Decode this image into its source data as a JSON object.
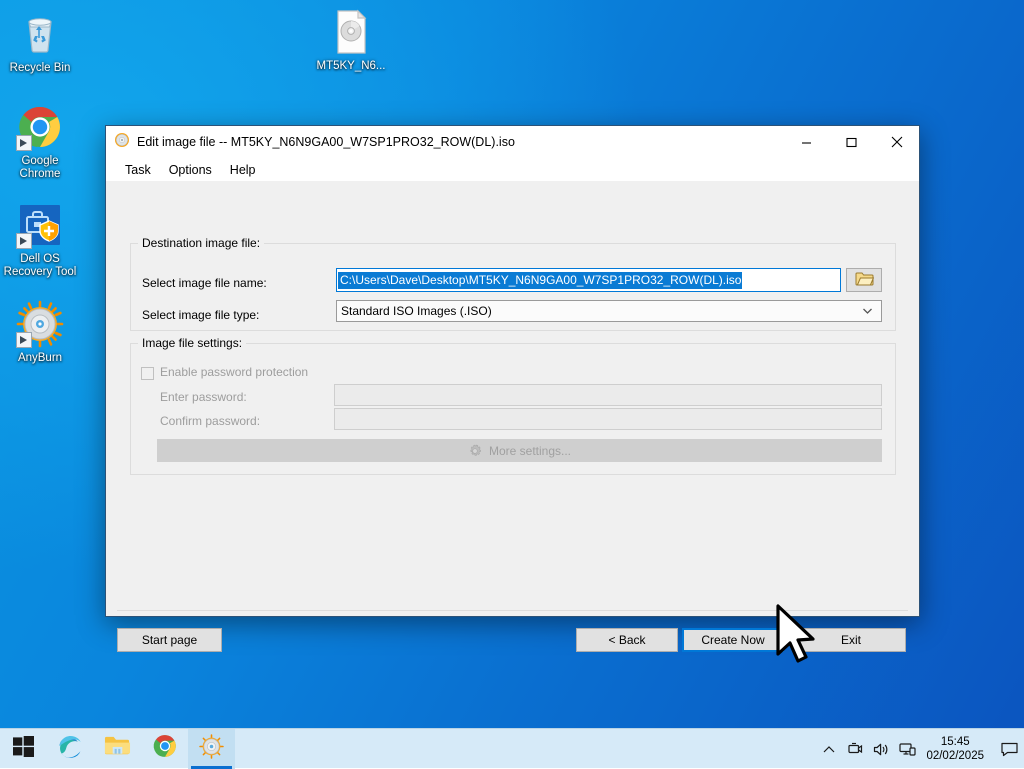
{
  "desktop": {
    "icons": [
      {
        "name": "recycle-bin",
        "label": "Recycle Bin",
        "icon": "recycle-bin-icon"
      },
      {
        "name": "google-chrome",
        "label": "Google\nChrome",
        "label_line1": "Google",
        "label_line2": "Chrome",
        "icon": "chrome-icon"
      },
      {
        "name": "dell-os-recovery-tool",
        "label_line1": "Dell OS",
        "label_line2": "Recovery Tool",
        "icon": "dell-recovery-icon"
      },
      {
        "name": "anyburn",
        "label_line1": "AnyBurn",
        "label_line2": "",
        "icon": "anyburn-disc-icon"
      },
      {
        "name": "iso-file",
        "label_line1": "MT5KY_N6...",
        "label_line2": "",
        "icon": "iso-file-icon"
      }
    ]
  },
  "window": {
    "title": "Edit image file -- MT5KY_N6N9GA00_W7SP1PRO32_ROW(DL).iso",
    "app_icon": "anyburn-disc-icon",
    "controls": {
      "minimize": "minimize-icon",
      "maximize": "maximize-icon",
      "close": "close-icon"
    },
    "menu": [
      {
        "name": "task",
        "label": "Task"
      },
      {
        "name": "options",
        "label": "Options"
      },
      {
        "name": "help",
        "label": "Help"
      }
    ],
    "destination_group": {
      "legend": "Destination image file:",
      "file_name_label": "Select image file name:",
      "file_name_value": "C:\\Users\\Dave\\Desktop\\MT5KY_N6N9GA00_W7SP1PRO32_ROW(DL).iso",
      "file_name_selected": true,
      "browse_icon": "folder-open-icon",
      "file_type_label": "Select image file type:",
      "file_type_value": "Standard ISO Images (.ISO)",
      "file_type_arrow": "chevron-down-icon"
    },
    "settings_group": {
      "legend": "Image file settings:",
      "enable_password_label": "Enable password protection",
      "enable_password_checked": false,
      "enter_password_label": "Enter password:",
      "enter_password_value": "",
      "confirm_password_label": "Confirm password:",
      "confirm_password_value": "",
      "more_settings_label": "More settings...",
      "more_settings_icon": "gear-icon",
      "more_settings_disabled": true
    },
    "buttons": {
      "start_page": "Start page",
      "back": "< Back",
      "create_now": "Create Now",
      "exit": "Exit",
      "focused": "create_now"
    }
  },
  "taskbar": {
    "items": [
      {
        "name": "start-button",
        "icon": "windows-logo-icon"
      },
      {
        "name": "microsoft-edge",
        "icon": "edge-icon"
      },
      {
        "name": "file-explorer",
        "icon": "folder-icon"
      },
      {
        "name": "google-chrome",
        "icon": "chrome-icon"
      },
      {
        "name": "anyburn",
        "icon": "anyburn-disc-icon",
        "active": true
      }
    ],
    "tray": [
      {
        "name": "show-hidden-icons",
        "icon": "chevron-up-icon"
      },
      {
        "name": "removable-media",
        "icon": "usb-eject-icon"
      },
      {
        "name": "volume",
        "icon": "speaker-icon"
      },
      {
        "name": "network",
        "icon": "monitor-network-icon"
      }
    ],
    "clock": {
      "time": "15:45",
      "date": "02/02/2025"
    },
    "action_center_icon": "speech-bubble-icon"
  },
  "colors": {
    "accent": "#0078d7",
    "selection": "#0a7bd4",
    "window_bg": "#f0f0f0",
    "taskbar_bg": "#d6eaf8"
  }
}
